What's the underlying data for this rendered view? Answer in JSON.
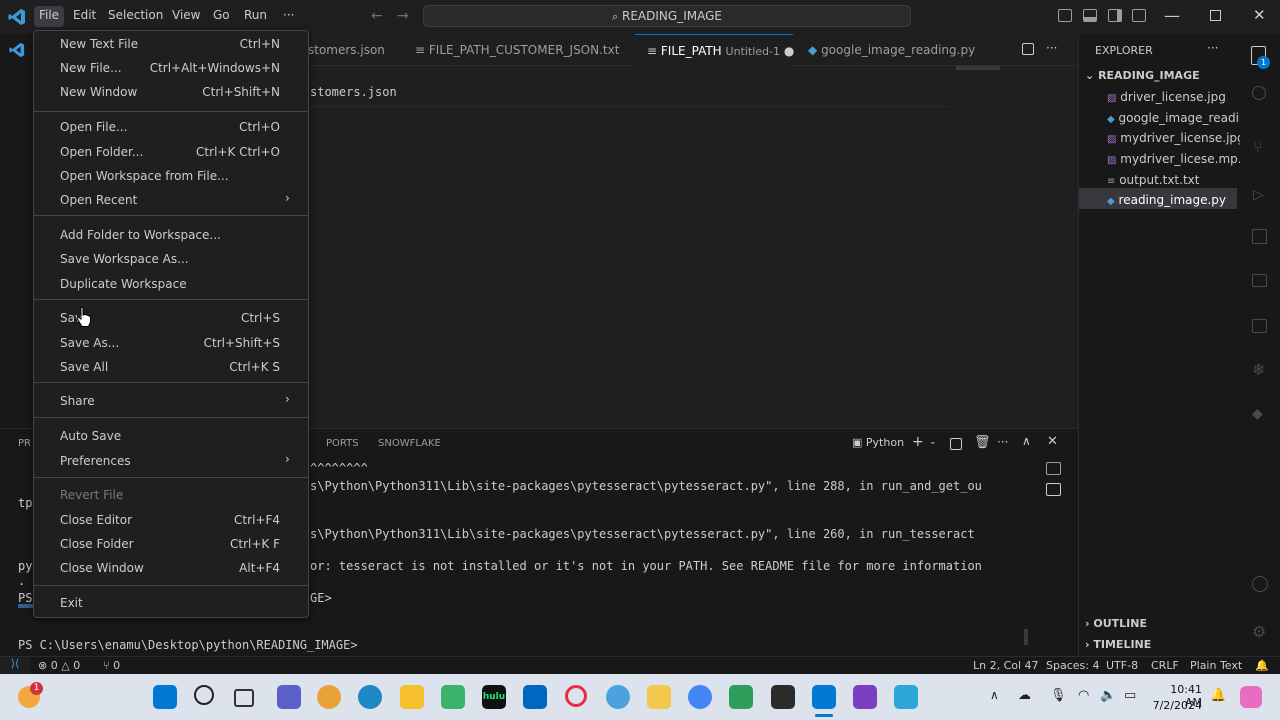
{
  "titlebar": {
    "menus": [
      "File",
      "Edit",
      "Selection",
      "View",
      "Go",
      "Run",
      "···"
    ],
    "search_text": "READING_IMAGE"
  },
  "tabs": [
    {
      "label": "stomers.json"
    },
    {
      "label": "FILE_PATH_CUSTOMER_JSON.txt"
    },
    {
      "label": "FILE_PATH",
      "extra": "Untitled-1",
      "active": true
    },
    {
      "label": "google_image_reading.py"
    }
  ],
  "editor": {
    "line1": "stomers.json"
  },
  "panel": {
    "tabs": [
      "PR",
      "PORTS",
      "SNOWFLAKE"
    ],
    "shell_label": "Python",
    "left_fragments": [
      "tp",
      "py",
      ".",
      "PS"
    ],
    "lines": [
      "^^^^^^^^",
      "s\\Python\\Python311\\Lib\\site-packages\\pytesseract\\pytesseract.py\", line 288, in run_and_get_ou",
      "s\\Python\\Python311\\Lib\\site-packages\\pytesseract\\pytesseract.py\", line 260, in run_tesseract",
      "or: tesseract is not installed or it's not in your PATH. See README file for more information",
      "GE>"
    ],
    "prompt": "PS C:\\Users\\enamu\\Desktop\\python\\READING_IMAGE>"
  },
  "explorer": {
    "title": "EXPLORER",
    "folder": "READING_IMAGE",
    "files": [
      {
        "name": "driver_license.jpg",
        "icon": "image-file-icon"
      },
      {
        "name": "google_image_readin...",
        "icon": "python-file-icon"
      },
      {
        "name": "mydriver_license.jpg",
        "icon": "image-file-icon"
      },
      {
        "name": "mydriver_licese.mp.jpg",
        "icon": "image-file-icon"
      },
      {
        "name": "output.txt.txt",
        "icon": "text-file-icon"
      },
      {
        "name": "reading_image.py",
        "icon": "python-file-icon",
        "selected": true
      }
    ],
    "outline": "OUTLINE",
    "timeline": "TIMELINE"
  },
  "statusbar": {
    "errors": "0",
    "warnings": "0",
    "ports": "0",
    "position": "Ln 2, Col 47",
    "spaces": "Spaces: 4",
    "encoding": "UTF-8",
    "eol": "CRLF",
    "language": "Plain Text"
  },
  "file_menu": {
    "groups": [
      [
        {
          "label": "New Text File",
          "key": "Ctrl+N"
        },
        {
          "label": "New File...",
          "key": "Ctrl+Alt+Windows+N"
        },
        {
          "label": "New Window",
          "key": "Ctrl+Shift+N"
        }
      ],
      [
        {
          "label": "Open File...",
          "key": "Ctrl+O"
        },
        {
          "label": "Open Folder...",
          "key": "Ctrl+K Ctrl+O"
        },
        {
          "label": "Open Workspace from File...",
          "key": ""
        },
        {
          "label": "Open Recent",
          "key": "",
          "submenu": true
        }
      ],
      [
        {
          "label": "Add Folder to Workspace...",
          "key": ""
        },
        {
          "label": "Save Workspace As...",
          "key": ""
        },
        {
          "label": "Duplicate Workspace",
          "key": ""
        }
      ],
      [
        {
          "label": "Save",
          "key": "Ctrl+S"
        },
        {
          "label": "Save As...",
          "key": "Ctrl+Shift+S"
        },
        {
          "label": "Save All",
          "key": "Ctrl+K S"
        }
      ],
      [
        {
          "label": "Share",
          "key": "",
          "submenu": true
        }
      ],
      [
        {
          "label": "Auto Save",
          "key": ""
        },
        {
          "label": "Preferences",
          "key": "",
          "submenu": true
        }
      ],
      [
        {
          "label": "Revert File",
          "key": "",
          "disabled": true
        },
        {
          "label": "Close Editor",
          "key": "Ctrl+F4"
        },
        {
          "label": "Close Folder",
          "key": "Ctrl+K F"
        },
        {
          "label": "Close Window",
          "key": "Alt+F4"
        }
      ],
      [
        {
          "label": "Exit",
          "key": ""
        }
      ]
    ]
  },
  "taskbar": {
    "time": "10:41 AM",
    "date": "7/2/2024",
    "badge": "1",
    "hulu": "hulu"
  },
  "colors": {
    "accent": "#0078d4",
    "background": "#1f1f1f",
    "panel": "#181818",
    "taskbar": "#dde3ec"
  }
}
